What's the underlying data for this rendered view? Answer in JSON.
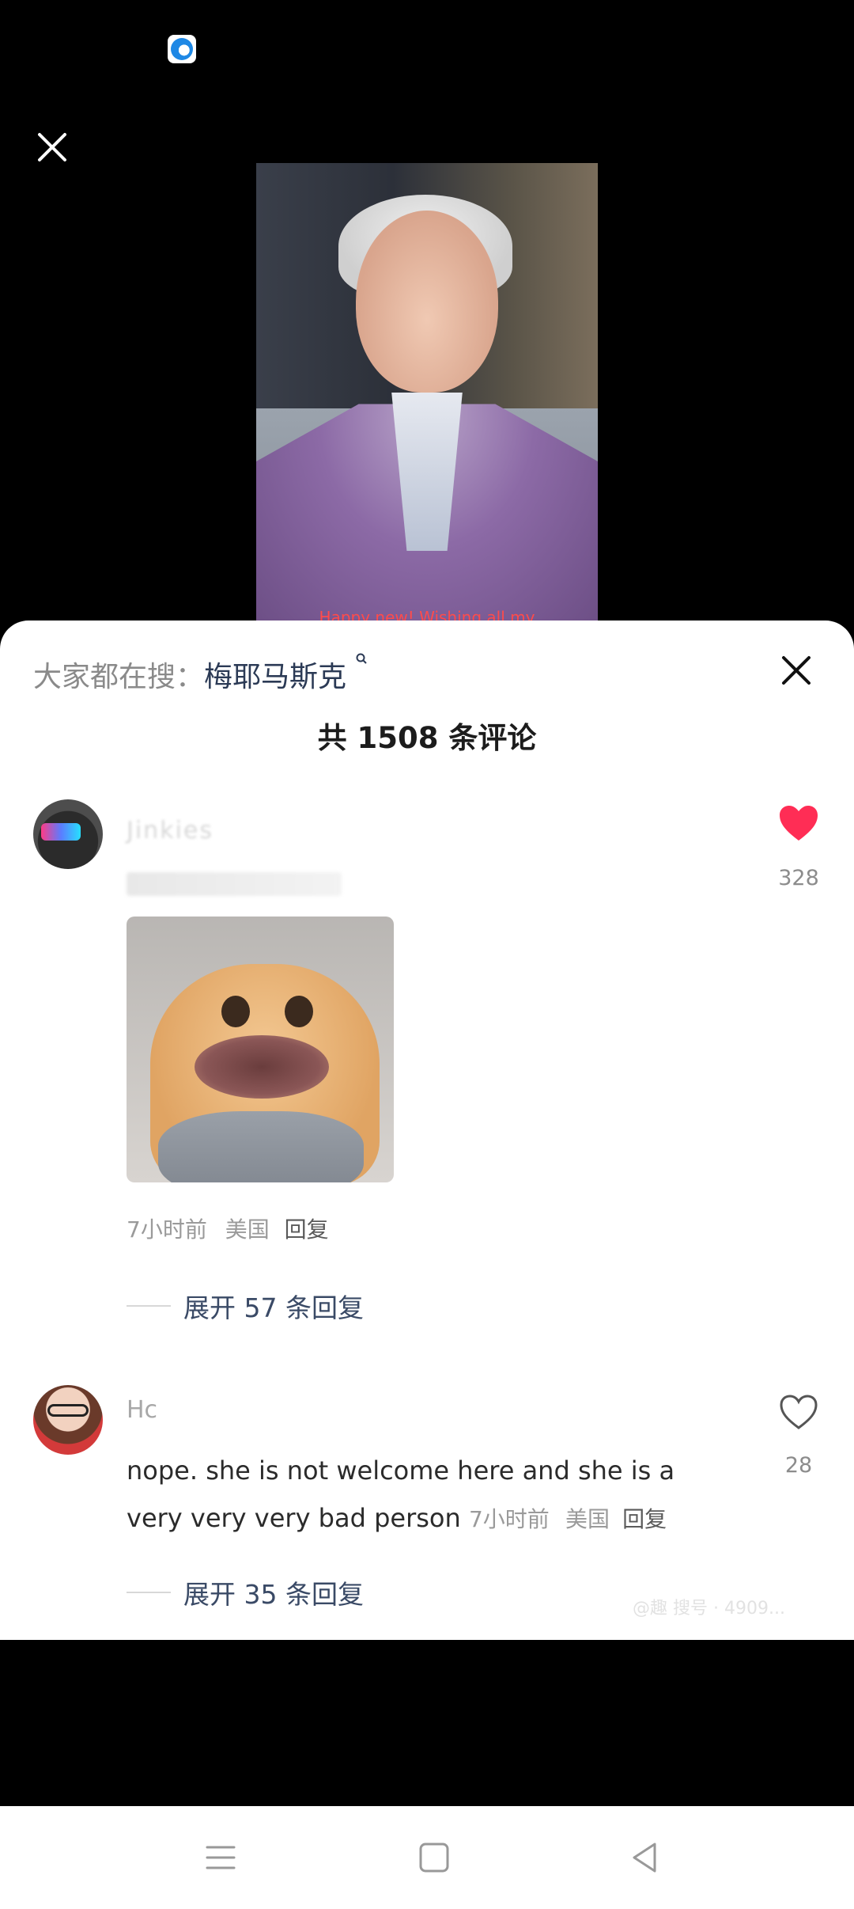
{
  "video": {
    "caption": "Happy new! Wishing all my"
  },
  "comments_panel": {
    "search_hint": {
      "prefix": "大家都在搜：",
      "term": "梅耶马斯克"
    },
    "title": "共 1508 条评论",
    "comments": [
      {
        "username": "Jinkies",
        "likes": "328",
        "liked": true,
        "time": "7小时前",
        "location": "美国",
        "reply_label": "回复",
        "expand_label": "展开 57 条回复"
      },
      {
        "username": "Hc",
        "text": "nope. she is not welcome here and she is a very very very bad person",
        "likes": "28",
        "liked": false,
        "time": "7小时前",
        "location": "美国",
        "reply_label": "回复",
        "expand_label": "展开 35 条回复"
      }
    ],
    "watermark": "@趣 搜号 · 4909..."
  },
  "colors": {
    "like_red": "#ff2d55",
    "link_blue": "#2b3a55"
  }
}
